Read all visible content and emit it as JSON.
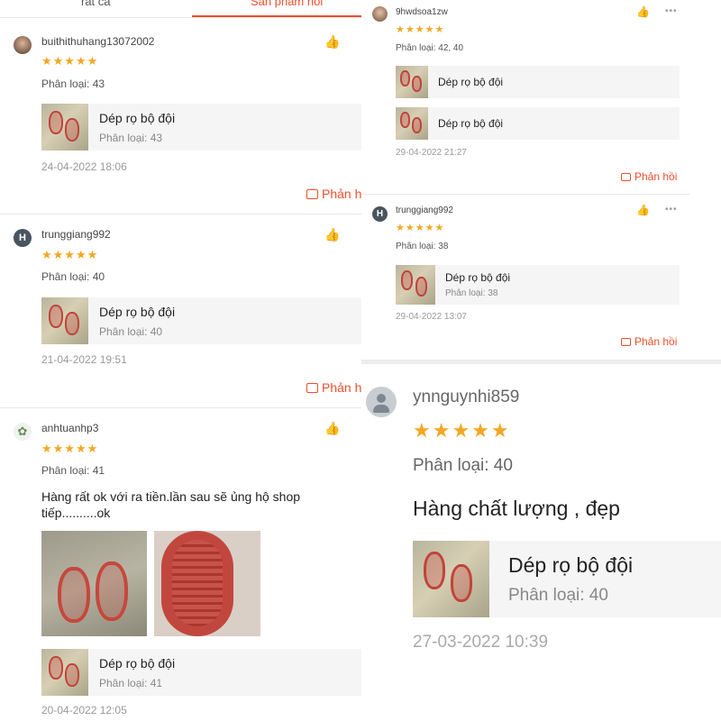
{
  "tabs": [
    "rất cả",
    "Sản phẩm hỏi"
  ],
  "product_name": "Dép rọ bộ đội",
  "reply_label": "Phản hồi",
  "reply_label_cut": "Phản h",
  "more_label": "•••",
  "left": [
    {
      "user": "buithithuhang13072002",
      "stars": "★★★★★",
      "variation": "Phân loại: 43",
      "pvar": "Phân loại: 43",
      "date": "24-04-2022 18:06",
      "avatar": "photo"
    },
    {
      "user": "trunggiang992",
      "stars": "★★★★★",
      "variation": "Phân loại: 40",
      "pvar": "Phân loại: 40",
      "date": "21-04-2022 19:51",
      "avatar": "H"
    },
    {
      "user": "anhtuanhp3",
      "stars": "★★★★★",
      "variation": "Phân loại: 41",
      "comment": "Hàng rất ok với ra tiền.lần sau sẽ ủng hộ shop tiếp..........ok",
      "pvar": "Phân loại: 41",
      "date": "20-04-2022 12:05",
      "avatar": "plant"
    }
  ],
  "top_right": [
    {
      "user": "9hwdsoa1zw",
      "stars": "★★★★★",
      "variation": "Phân loại: 42, 40",
      "date": "29-04-2022 21:27",
      "avatar": "photo"
    },
    {
      "user": "trunggiang992",
      "stars": "★★★★★",
      "variation": "Phân loại: 38",
      "pvar": "Phân loại: 38",
      "date": "29-04-2022 13:07",
      "avatar": "H"
    }
  ],
  "bottom_right": {
    "user": "ynnguynhi859",
    "stars": "★★★★★",
    "variation": "Phân loại: 40",
    "comment": "Hàng chất lượng , đẹp",
    "pvar": "Phân loại: 40",
    "date": "27-03-2022 10:39",
    "avatar": "default"
  },
  "colors": {
    "accent": "#ee4d2d",
    "star": "#f5a623",
    "avatar_h": "#4a5560",
    "product_bg": "#f5f5f5"
  }
}
